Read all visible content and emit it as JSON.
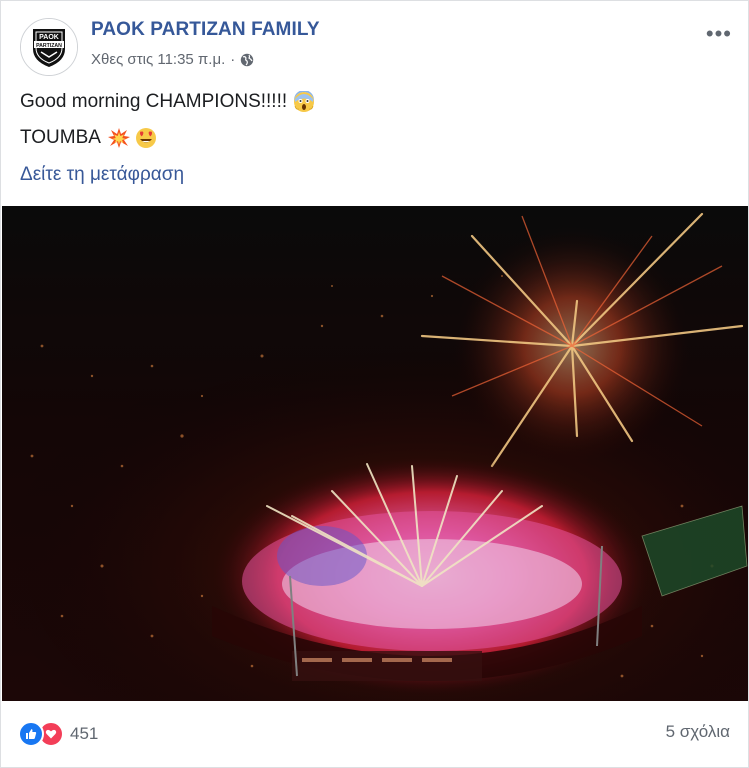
{
  "post": {
    "page_name": "PAOK PARTIZAN FAMILY",
    "timestamp": "Χθες στις 11:35 π.μ.",
    "separator": "·",
    "privacy_icon": "globe-icon",
    "avatar_logo": "PAOK PARTIZAN",
    "more_icon": "more-options-icon",
    "more_label": "•••",
    "line1": {
      "text": "Good morning CHAMPIONS!!!!!",
      "emoji": "face-screaming-in-fear"
    },
    "line2": {
      "text": "TOUMBA",
      "emojis": [
        "collision",
        "smiling-face-with-heart-eyes"
      ]
    },
    "see_translation": "Δείτε τη μετάφραση",
    "photo": {
      "description_icon": "stadium-fireworks-photo"
    },
    "reactions": {
      "types": [
        "like",
        "love"
      ],
      "count": "451"
    },
    "comments_label": "5 σχόλια",
    "colors": {
      "link": "#365899",
      "meta": "#616770",
      "like": "#1877f2",
      "love": "#f33e58"
    }
  }
}
